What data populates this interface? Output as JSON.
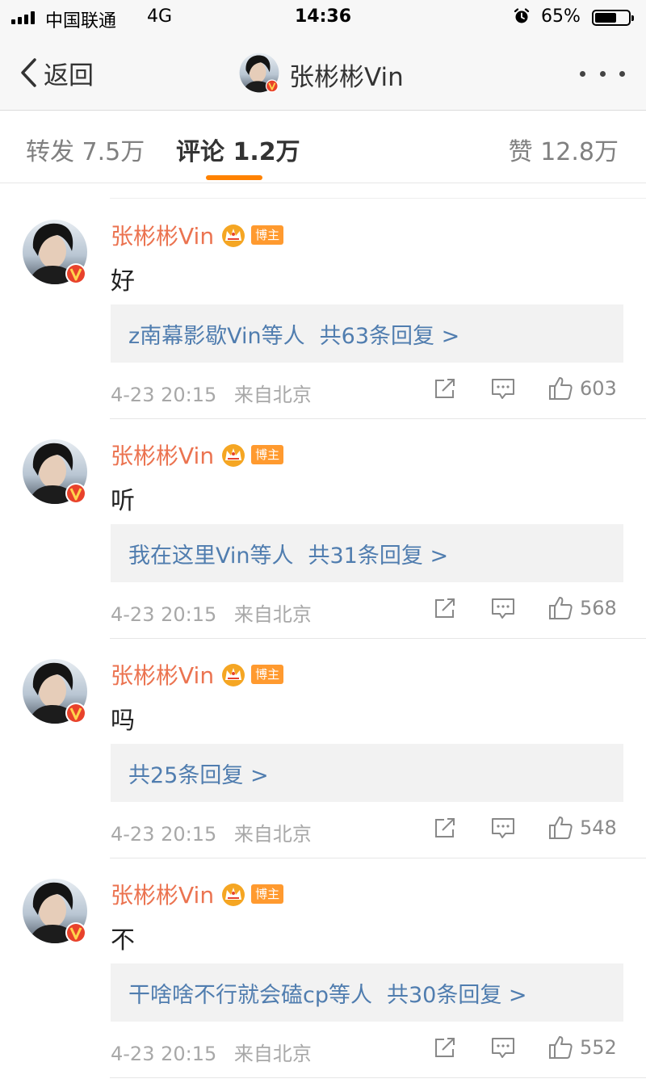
{
  "status_bar": {
    "carrier": "中国联通",
    "network": "4G",
    "time": "14:36",
    "battery": "65%",
    "battery_level": 0.65,
    "icons": [
      "signal-icon",
      "alarm-icon",
      "battery-icon"
    ]
  },
  "nav": {
    "back_label": "返回",
    "title": "张彬彬Vin",
    "icons": [
      "chevron-left-icon",
      "more-icon"
    ]
  },
  "tabs": {
    "repost": "转发 7.5万",
    "comment": "评论 1.2万",
    "like": "赞 12.8万",
    "active": "comment"
  },
  "colors": {
    "accent": "#ff8200",
    "author_name": "#eb7350",
    "link": "#507daf",
    "verified": "#e8422b",
    "badge": "#ff9a2f",
    "crown": "#f5a623"
  },
  "comments": [
    {
      "author": "张彬彬Vin",
      "badge": "博主",
      "text": "好",
      "reply_users": "z南幕影歇Vin等人",
      "reply_count": "共63条回复 >",
      "time": "4-23 20:15",
      "source": "来自北京",
      "likes": "603"
    },
    {
      "author": "张彬彬Vin",
      "badge": "博主",
      "text": "听",
      "reply_users": "我在这里Vin等人",
      "reply_count": "共31条回复 >",
      "time": "4-23 20:15",
      "source": "来自北京",
      "likes": "568"
    },
    {
      "author": "张彬彬Vin",
      "badge": "博主",
      "text": "吗",
      "reply_users": "",
      "reply_count": "共25条回复 >",
      "time": "4-23 20:15",
      "source": "来自北京",
      "likes": "548"
    },
    {
      "author": "张彬彬Vin",
      "badge": "博主",
      "text": "不",
      "reply_users": "干啥啥不行就会磕cp等人",
      "reply_count": "共30条回复 >",
      "time": "4-23 20:15",
      "source": "来自北京",
      "likes": "552"
    }
  ]
}
